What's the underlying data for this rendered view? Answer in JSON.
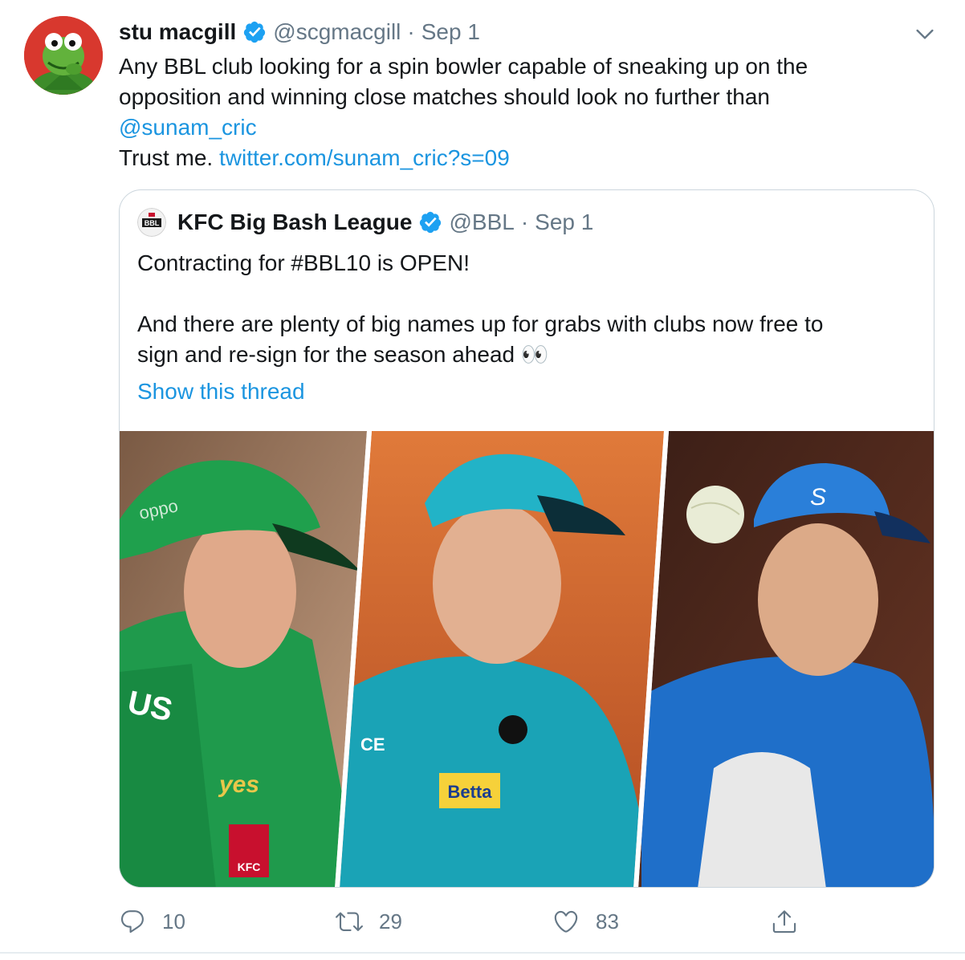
{
  "tweet": {
    "author_name": "stu macgill",
    "author_handle": "@scgmacgill",
    "separator": "·",
    "date": "Sep 1",
    "avatar_icon": "kermit-frog-avatar",
    "text_lines": [
      "Any BBL club looking for a spin bowler capable of sneaking up on the",
      "opposition and winning close matches should look no further than"
    ],
    "mention": "@sunam_cric",
    "trust_text": "Trust me. ",
    "url": "twitter.com/sunam_cric?s=09"
  },
  "quoted": {
    "author_name": "KFC Big Bash League",
    "author_handle": "@BBL",
    "separator": "·",
    "date": "Sep 1",
    "logo_text": "BBL",
    "text_lines": [
      "Contracting for #BBL10 is OPEN!",
      "",
      "And there are plenty of big names up for grabs with clubs now free to",
      "sign and re-sign for the season ahead 👀"
    ],
    "show_thread": "Show this thread",
    "media": {
      "panel_1": {
        "cap_text": "oppo",
        "shirt_text": "yes",
        "badge_text": "KFC",
        "sleeve_text": "US"
      },
      "panel_2": {
        "sponsor_text": "Betta",
        "badge_text": "CE"
      },
      "panel_3": {
        "logo_text": "S"
      }
    }
  },
  "actions": {
    "reply_count": "10",
    "retweet_count": "29",
    "like_count": "83"
  },
  "colors": {
    "link": "#1b95e0",
    "verified": "#1da1f2",
    "muted": "#657786",
    "border": "#ccd6dd"
  }
}
